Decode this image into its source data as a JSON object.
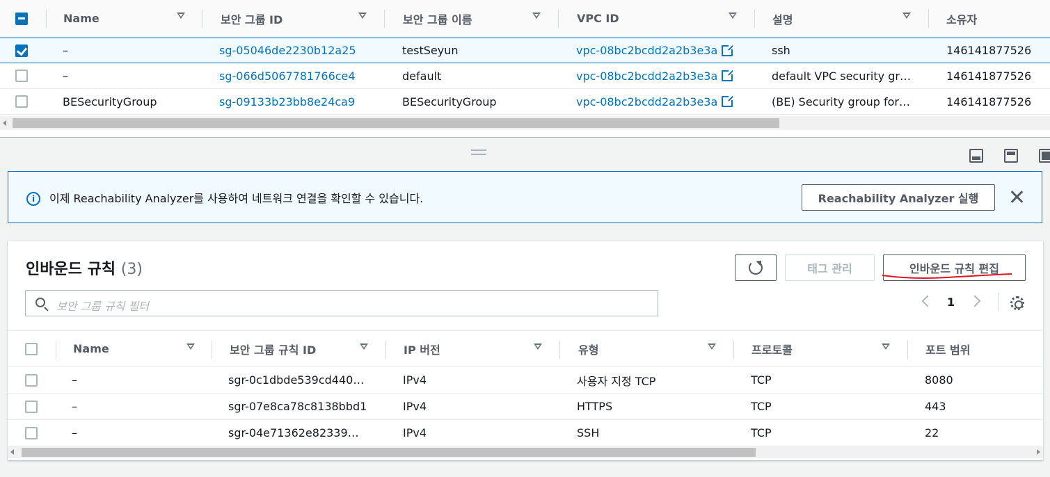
{
  "sg_table": {
    "headers": [
      "Name",
      "보안 그룹 ID",
      "보안 그룹 이름",
      "VPC ID",
      "설명",
      "소유자"
    ],
    "rows": [
      {
        "name": "–",
        "sg_id": "sg-05046de2230b12a25",
        "sg_name": "testSeyun",
        "vpc_id": "vpc-08bc2bcdd2a2b3e3a",
        "desc": "ssh",
        "owner": "146141877526",
        "selected": true
      },
      {
        "name": "–",
        "sg_id": "sg-066d5067781766ce4",
        "sg_name": "default",
        "vpc_id": "vpc-08bc2bcdd2a2b3e3a",
        "desc": "default VPC security gr…",
        "owner": "146141877526",
        "selected": false
      },
      {
        "name": "BESecurityGroup",
        "sg_id": "sg-09133b23bb8e24ca9",
        "sg_name": "BESecurityGroup",
        "vpc_id": "vpc-08bc2bcdd2a2b3e3a",
        "desc": "(BE) Security group for…",
        "owner": "146141877526",
        "selected": false
      }
    ]
  },
  "flash": {
    "message": "이제 Reachability Analyzer를 사용하여 네트워크 연결을 확인할 수 있습니다.",
    "button": "Reachability Analyzer 실행",
    "info_icon": "info-icon",
    "close_icon": "close-icon"
  },
  "inbound": {
    "title": "인바운드 규칙",
    "count": "(3)",
    "tag_button": "태그 관리",
    "edit_button": "인바운드 규칙 편집",
    "search_placeholder": "보안 그룹 규칙 필터",
    "page": "1",
    "headers": [
      "Name",
      "보안 그룹 규칙 ID",
      "IP 버전",
      "유형",
      "프로토콜",
      "포트 범위"
    ],
    "rows": [
      {
        "name": "–",
        "rule_id": "sgr-0c1dbde539cd440…",
        "ip": "IPv4",
        "type": "사용자 지정 TCP",
        "protocol": "TCP",
        "port": "8080"
      },
      {
        "name": "–",
        "rule_id": "sgr-07e8ca78c8138bbd1",
        "ip": "IPv4",
        "type": "HTTPS",
        "protocol": "TCP",
        "port": "443"
      },
      {
        "name": "–",
        "rule_id": "sgr-04e71362e82339…",
        "ip": "IPv4",
        "type": "SSH",
        "protocol": "TCP",
        "port": "22"
      }
    ]
  },
  "colors": {
    "link": "#0073bb",
    "annotation_underline": "#e0121f"
  }
}
